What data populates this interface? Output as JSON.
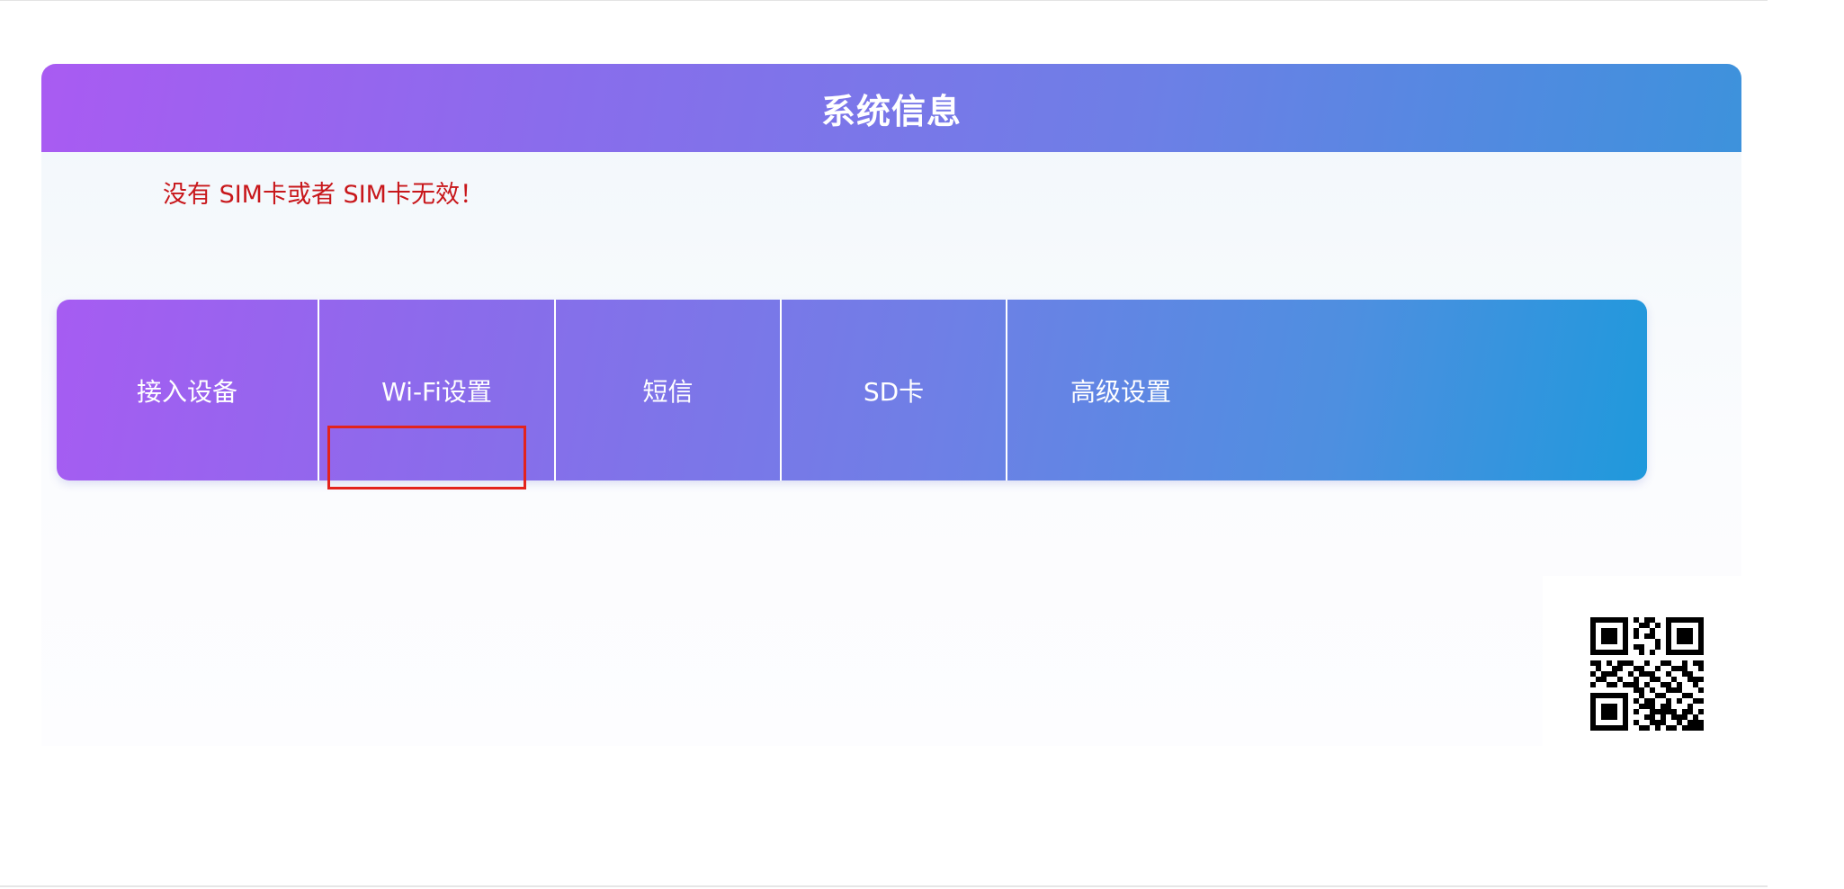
{
  "header": {
    "title": "系统信息"
  },
  "status": {
    "message": "没有 SIM卡或者 SIM卡无效！"
  },
  "nav": {
    "items": [
      {
        "label": "接入设备"
      },
      {
        "label": "Wi-Fi设置"
      },
      {
        "label": "短信"
      },
      {
        "label": "SD卡"
      },
      {
        "label": "高级设置"
      }
    ],
    "highlighted": "Wi-Fi设置"
  },
  "colors": {
    "header_gradient_start": "#a95bf2",
    "header_gradient_end": "#3d92dc",
    "warning_text": "#c8171b",
    "highlight_border": "#e3231d"
  },
  "icons": {
    "qr": "qr-code-icon"
  }
}
